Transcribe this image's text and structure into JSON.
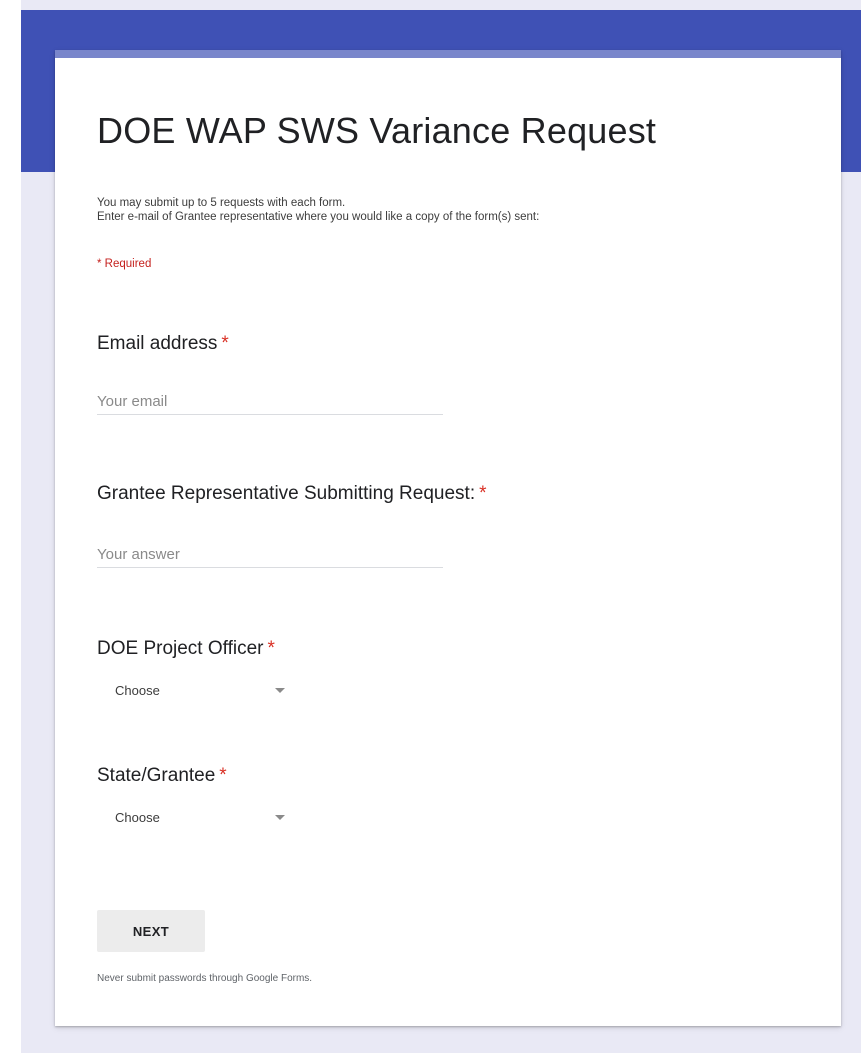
{
  "form": {
    "title": "DOE WAP SWS Variance Request",
    "description_line1": "You may submit up to 5 requests with each form.",
    "description_line2": "Enter e-mail of Grantee representative where you would like a copy of the form(s) sent:",
    "required_note": "* Required",
    "asterisk": "*"
  },
  "questions": {
    "email": {
      "label": "Email address",
      "placeholder": "Your email",
      "value": ""
    },
    "grantee_rep": {
      "label": "Grantee Representative Submitting Request:",
      "placeholder": "Your answer",
      "value": ""
    },
    "project_officer": {
      "label": "DOE Project Officer",
      "selected": "Choose"
    },
    "state_grantee": {
      "label": "State/Grantee",
      "selected": "Choose"
    }
  },
  "actions": {
    "next_label": "NEXT"
  },
  "footer": {
    "note": "Never submit passwords through Google Forms."
  },
  "colors": {
    "header": "#3f51b5",
    "card_accent": "#7986cb",
    "required": "#d93025",
    "background": "#e9e9f5"
  }
}
